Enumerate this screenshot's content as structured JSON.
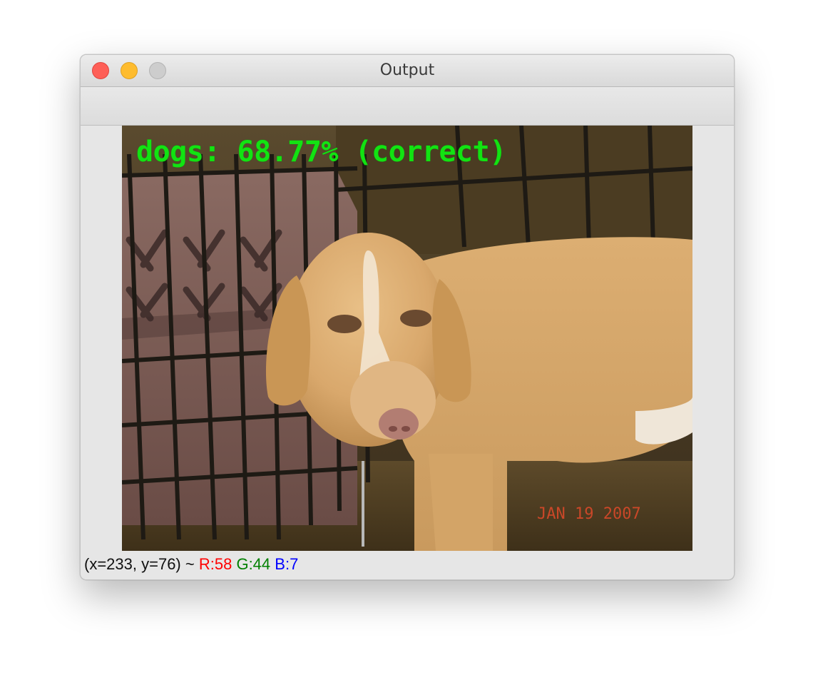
{
  "window": {
    "title": "Output",
    "controls": [
      "close",
      "minimize",
      "zoom"
    ]
  },
  "image": {
    "prediction_label": "dogs: 68.77% (correct)",
    "date_stamp": "JAN 19 2007",
    "label_color": "#12e312"
  },
  "status": {
    "coords": "(x=233, y=76) ~",
    "r": "R:58",
    "g": "G:44",
    "b": "B:7",
    "r_color": "#ff0000",
    "g_color": "#008000",
    "b_color": "#0000ff"
  }
}
